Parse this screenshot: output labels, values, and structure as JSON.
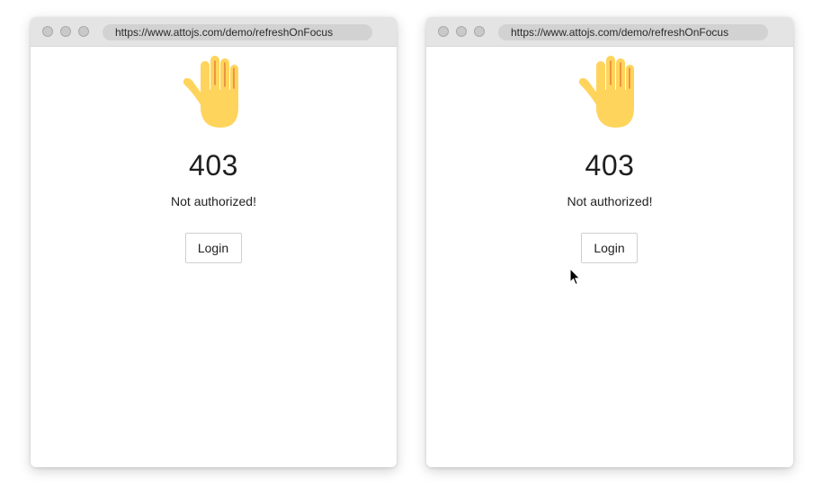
{
  "windows": [
    {
      "url": "https://www.attojs.com/demo/refreshOnFocus",
      "status_code": "403",
      "message": "Not authorized!",
      "button_label": "Login"
    },
    {
      "url": "https://www.attojs.com/demo/refreshOnFocus",
      "status_code": "403",
      "message": "Not authorized!",
      "button_label": "Login"
    }
  ],
  "icons": {
    "hand": "raised-hand-icon",
    "cursor": "mouse-pointer-icon"
  },
  "colors": {
    "hand_fill": "#FFD45C",
    "hand_lines": "#E8873A",
    "titlebar": "#e4e4e4"
  }
}
